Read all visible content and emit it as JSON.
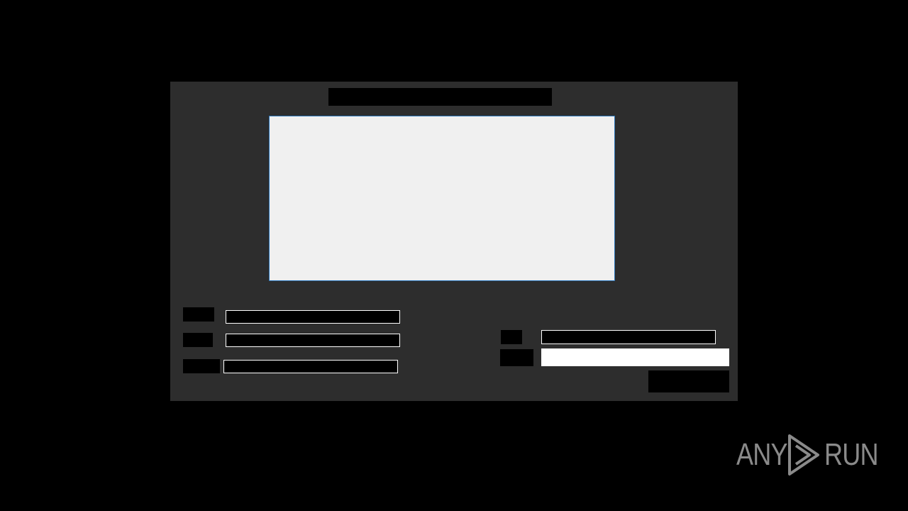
{
  "dialog": {
    "title": "",
    "fields_left": [
      {
        "label": "",
        "value": ""
      },
      {
        "label": "",
        "value": ""
      },
      {
        "label": "",
        "value": ""
      }
    ],
    "fields_right": [
      {
        "label": "",
        "value": ""
      },
      {
        "label": "",
        "value": ""
      }
    ],
    "action_label": ""
  },
  "watermark": {
    "text_left": "ANY",
    "text_right": "RUN",
    "icon": "play-triangle-logo-icon"
  },
  "colors": {
    "screen_bg": "#000000",
    "dialog_bg": "#2d2d2d",
    "preview_bg": "#f0f0f0",
    "preview_border": "#2b74b8",
    "watermark": "#8a8a8a"
  }
}
